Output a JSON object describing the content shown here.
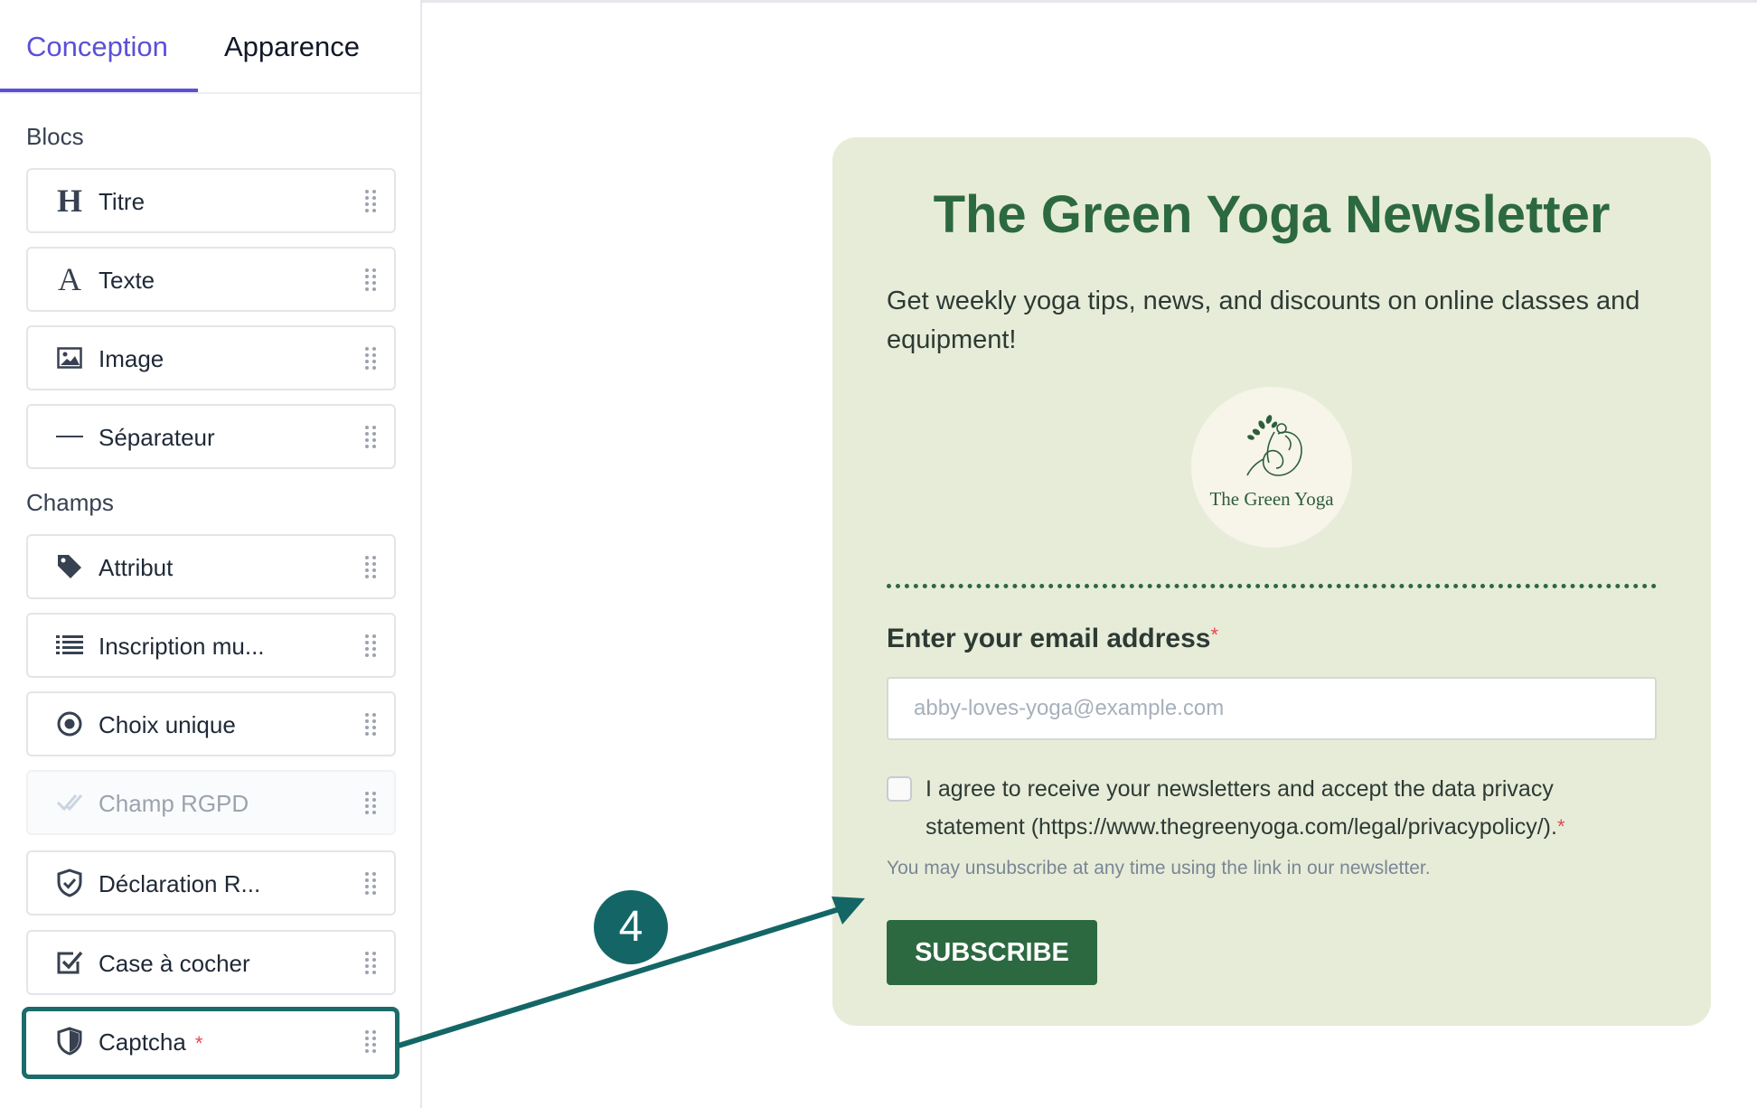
{
  "sidebar": {
    "tabs": [
      {
        "label": "Conception",
        "active": true
      },
      {
        "label": "Apparence",
        "active": false
      }
    ],
    "sections": {
      "blocs": "Blocs",
      "champs": "Champs"
    },
    "blocs": [
      {
        "label": "Titre",
        "icon": "heading-icon"
      },
      {
        "label": "Texte",
        "icon": "text-icon"
      },
      {
        "label": "Image",
        "icon": "image-icon"
      },
      {
        "label": "Séparateur",
        "icon": "separator-icon"
      }
    ],
    "champs": [
      {
        "label": "Attribut",
        "icon": "tag-icon"
      },
      {
        "label": "Inscription mu...",
        "icon": "list-icon"
      },
      {
        "label": "Choix unique",
        "icon": "radio-icon"
      },
      {
        "label": "Champ RGPD",
        "icon": "check-icon",
        "disabled": true
      },
      {
        "label": "Déclaration R...",
        "icon": "shield-check-icon"
      },
      {
        "label": "Case à cocher",
        "icon": "checkbox-icon"
      },
      {
        "label": "Captcha",
        "icon": "shield-icon",
        "required_mark": "*",
        "highlighted": true
      }
    ]
  },
  "form": {
    "title": "The Green Yoga Newsletter",
    "subtitle": "Get weekly yoga tips, news, and discounts on online classes and equipment!",
    "logo_text": "The Green Yoga",
    "email_label": "Enter your email address",
    "required_mark": "*",
    "email_placeholder": "abby-loves-yoga@example.com",
    "consent_text": "I agree to receive your newsletters and accept the data privacy statement (https://www.thegreenyoga.com/legal/privacypolicy/).",
    "unsubscribe_text": "You may unsubscribe at any time using the link in our newsletter.",
    "subscribe_label": "SUBSCRIBE"
  },
  "annotation": {
    "step": "4"
  },
  "colors": {
    "accent": "#5b50d6",
    "form_bg": "#e7ecd9",
    "brand_green": "#2c6941",
    "annotation_teal": "#146666",
    "required": "#e5484d"
  }
}
